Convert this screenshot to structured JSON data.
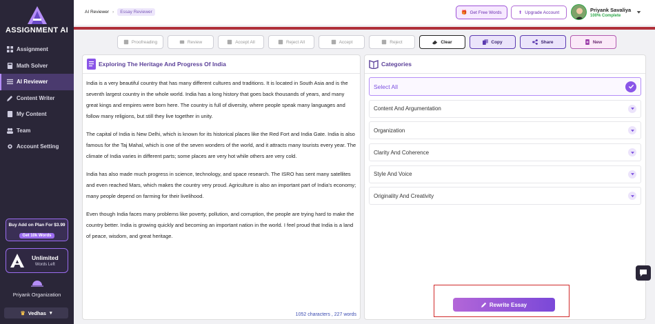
{
  "brand": {
    "name": "ASSIGNMENT AI",
    "accent": "#9b6cf0",
    "sidebar_bg": "#2a2638"
  },
  "sidebar": {
    "items": [
      {
        "label": "Assignment",
        "icon": "grid-icon"
      },
      {
        "label": "Math Solver",
        "icon": "calculator-icon"
      },
      {
        "label": "AI Reviewer",
        "icon": "list-icon",
        "active": true
      },
      {
        "label": "Content Writer",
        "icon": "pen-icon"
      },
      {
        "label": "My Content",
        "icon": "folder-icon"
      },
      {
        "label": "Team",
        "icon": "team-icon"
      },
      {
        "label": "Account Setting",
        "icon": "gear-icon"
      }
    ],
    "promo": {
      "title": "Buy Add on Plan For $3.99",
      "button": "Get 10k Words"
    },
    "plan": {
      "title": "Unlimited",
      "subtitle": "Words Left"
    },
    "organization": "Priyank Organization",
    "workspace": "Vedhas"
  },
  "header": {
    "breadcrumb": [
      "AI Reviewer",
      "Essay Reviewer"
    ],
    "free_words": "Get Free Words",
    "upgrade": "Upgrade Account",
    "user_name": "Priyank Savaliya",
    "user_status": "100% Complete"
  },
  "toolbar": {
    "proofreading": "Proofreading",
    "review": "Review",
    "accept_all": "Accept All",
    "reject_all": "Reject All",
    "accept": "Accept",
    "reject": "Reject",
    "clear": "Clear",
    "copy": "Copy",
    "share": "Share",
    "new": "New"
  },
  "essay": {
    "title": "Exploring The Heritage And Progress Of India",
    "paragraphs": [
      "India is a very beautiful country that has many different cultures and traditions. It is located in South Asia and is the seventh largest country in the whole world. India has a long history that goes back thousands of years, and many great kings and empires were born here. The country is full of diversity, where people speak many languages and follow many religions, but still they live together in unity.",
      "The capital of India is New Delhi, which is known for its historical places like the Red Fort and India Gate. India is also famous for the Taj Mahal, which is one of the seven wonders of the world, and it attracts many tourists every year. The climate of India varies in different parts; some places are very hot while others are very cold.",
      "India has also made much progress in science, technology, and space research. The ISRO has sent many satellites and even reached Mars, which makes the country very proud. Agriculture is also an important part of India's economy; many people depend on farming for their livelihood.",
      "Even though India faces many problems like poverty, pollution, and corruption, the people are trying hard to make the country better. India is growing quickly and becoming an important nation in the world. I feel proud that India is a land of peace, wisdom, and great heritage."
    ],
    "count": "1052 characters , 227 words"
  },
  "categories": {
    "title": "Categories",
    "items": [
      "Select All",
      "Content And Argumentation",
      "Organization",
      "Clarity And Coherence",
      "Style And Voice",
      "Originality And Creativity"
    ],
    "rewrite": "Rewrite Essay"
  }
}
